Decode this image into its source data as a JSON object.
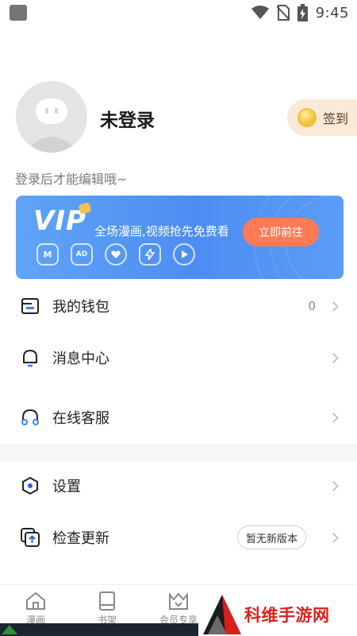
{
  "status_bar": {
    "time": "9:45"
  },
  "profile": {
    "login_title": "未登录",
    "checkin_label": "签到",
    "edit_hint": "登录后才能编辑哦~"
  },
  "vip_banner": {
    "logo": "VIP",
    "description": "全场漫画,视频抢先免费看",
    "button_label": "立即前往",
    "perk_icons": [
      "M",
      "AD",
      "heart",
      "bolt",
      "play"
    ]
  },
  "menu": {
    "wallet": {
      "label": "我的钱包",
      "value": "0"
    },
    "messages": {
      "label": "消息中心"
    },
    "support": {
      "label": "在线客服"
    },
    "settings": {
      "label": "设置"
    },
    "update": {
      "label": "检查更新",
      "badge": "暂无新版本"
    }
  },
  "tabs": [
    {
      "label": "漫画",
      "icon": "home-icon"
    },
    {
      "label": "书架",
      "icon": "book-icon"
    },
    {
      "label": "会员专享",
      "icon": "vip-crown-icon"
    }
  ],
  "watermark": {
    "text": "科维手游网"
  },
  "colors": {
    "vip_blue": "#4d8df2",
    "vip_button": "#ff7a55",
    "checkin_bg": "#fbe9d8",
    "watermark_red": "#d9211c"
  }
}
